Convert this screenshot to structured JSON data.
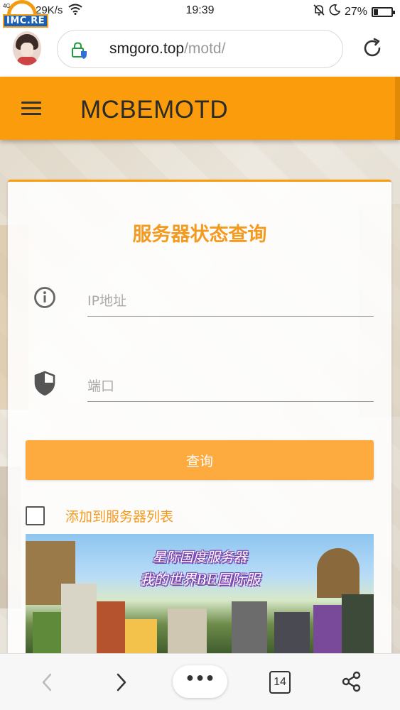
{
  "status_bar": {
    "network": "4G",
    "speed": "29K/s",
    "time": "19:39",
    "battery": "27%",
    "battery_level": 0.27
  },
  "overlay_logo": {
    "text": "IMC.RE"
  },
  "browser": {
    "url_host": "smgoro.top",
    "url_path": "/motd/",
    "tab_count": "14",
    "more_label": "•••"
  },
  "header": {
    "title": "MCBEMOTD"
  },
  "card": {
    "title": "服务器状态查询",
    "ip_placeholder": "IP地址",
    "port_placeholder": "端口",
    "query_button": "查询",
    "add_to_list_label": "添加到服务器列表"
  },
  "banner": {
    "line1": "星际国度服务器",
    "line2": "我的世界BE国际服"
  },
  "colors": {
    "accent": "#fb9c0c",
    "button": "#fdab3f",
    "title_text": "#f39a1f"
  }
}
